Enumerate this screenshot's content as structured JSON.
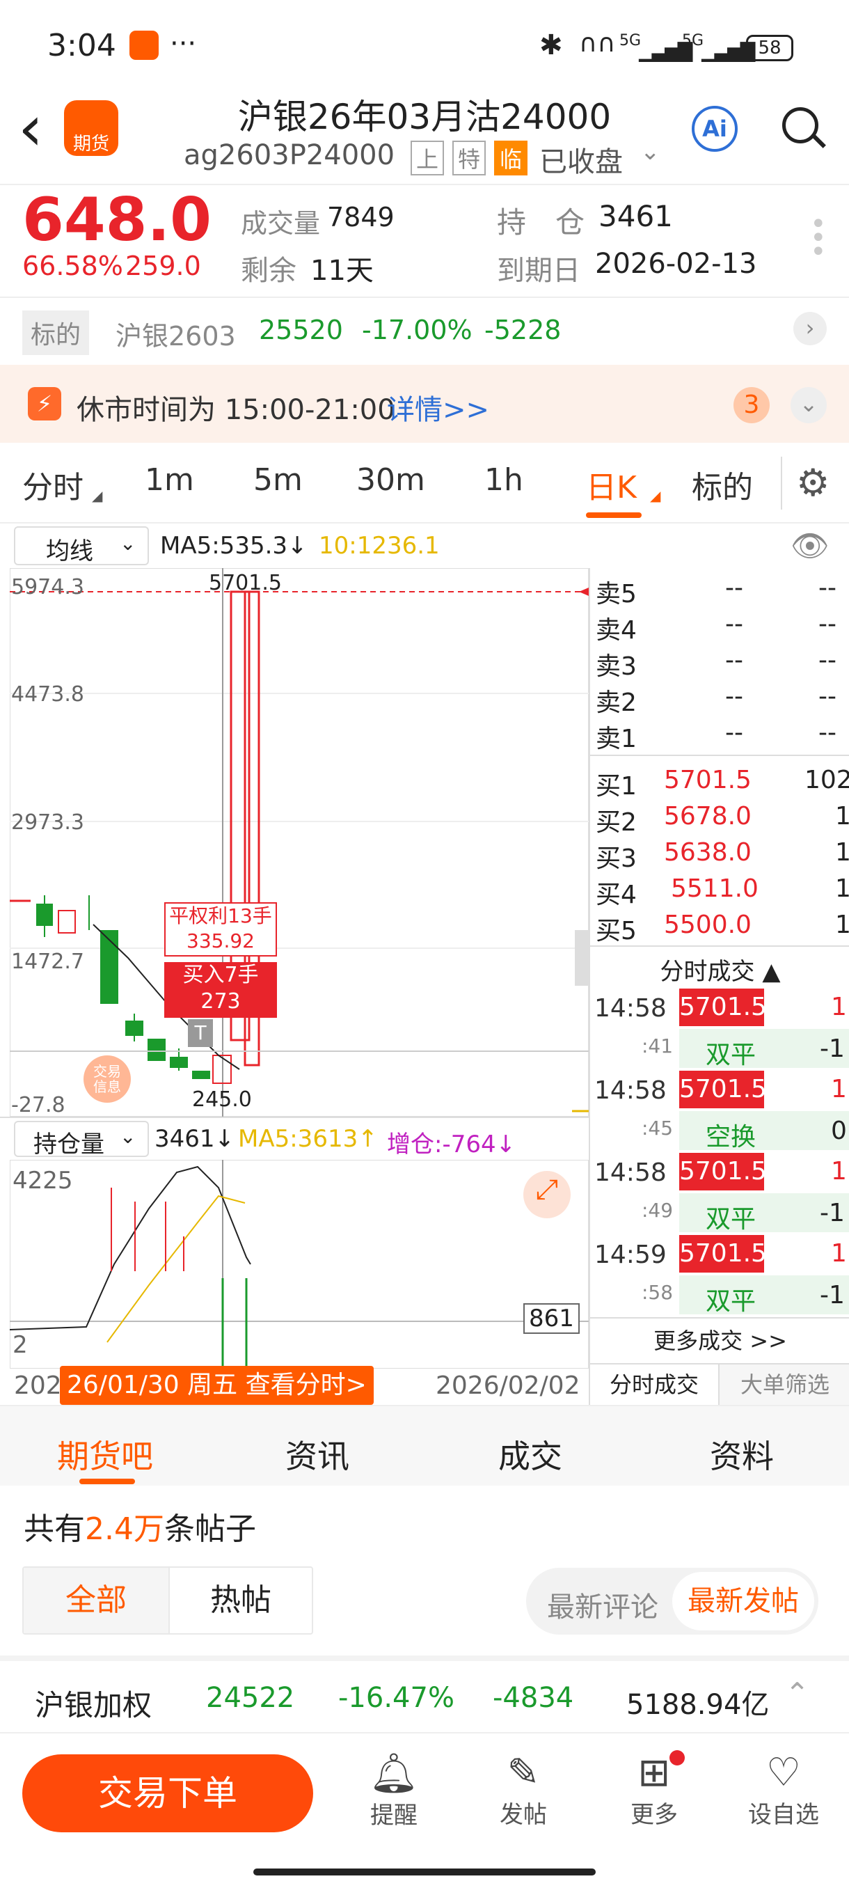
{
  "status": {
    "time": "3:04",
    "dots": "···",
    "battery": "58",
    "sig1": "5G",
    "sig2": "5G"
  },
  "header": {
    "back": "‹",
    "logo_text": "期货",
    "title": "沪银26年03月沽24000",
    "code": "ag2603P24000",
    "tags": [
      "上",
      "特",
      "临"
    ],
    "closed": "已收盘",
    "ai": "Ai"
  },
  "quote": {
    "price": "648.0",
    "change_pct": "66.58%",
    "change": "259.0",
    "volume_label": "成交量",
    "volume": "7849",
    "oi_label": "持　仓",
    "oi": "3461",
    "remain_label": "剩余",
    "remain": "11天",
    "expiry_label": "到期日",
    "expiry": "2026-02-13"
  },
  "underlying": {
    "tag": "标的",
    "name": "沪银2603",
    "price": "25520",
    "pct": "-17.00%",
    "chg": "-5228"
  },
  "notice": {
    "text": "休市时间为 15:00-21:00",
    "link": "详情>>",
    "badge": "3"
  },
  "tabs": [
    "分时",
    "1m",
    "5m",
    "30m",
    "1h",
    "日K",
    "标的"
  ],
  "ma": {
    "select": "均线",
    "ma5": "MA5:535.3↓",
    "ma10": "10:1236.1"
  },
  "chart": {
    "y": [
      "5974.3",
      "4473.8",
      "2973.3",
      "1472.7",
      "-27.8"
    ],
    "high_label": "5701.5",
    "low_label": "245.0",
    "ann1_l1": "平权利13手",
    "ann1_l2": "335.92",
    "ann2_l1": "买入7手",
    "ann2_l2": "273",
    "trade_info": "交易信息",
    "t_mark": "T"
  },
  "oi_chart": {
    "select": "持仓量",
    "value": "3461↓",
    "ma5": "MA5:3613↑",
    "add": "增仓:-764↓",
    "y_top": "4225",
    "y_bot": "2",
    "marker": "861",
    "date_left": "202",
    "date_tag": "26/01/30 周五 查看分时>",
    "date_right": "2026/02/02"
  },
  "sell": [
    {
      "l": "卖5",
      "p": "--",
      "v": "--"
    },
    {
      "l": "卖4",
      "p": "--",
      "v": "--"
    },
    {
      "l": "卖3",
      "p": "--",
      "v": "--"
    },
    {
      "l": "卖2",
      "p": "--",
      "v": "--"
    },
    {
      "l": "卖1",
      "p": "--",
      "v": "--"
    }
  ],
  "buy": [
    {
      "l": "买1",
      "p": "5701.5",
      "v": "102"
    },
    {
      "l": "买2",
      "p": "5678.0",
      "v": "1"
    },
    {
      "l": "买3",
      "p": "5638.0",
      "v": "1"
    },
    {
      "l": "买4",
      "p": "5511.0",
      "v": "1"
    },
    {
      "l": "买5",
      "p": "5500.0",
      "v": "1"
    }
  ],
  "trades_title": "分时成交",
  "trades": [
    {
      "t": "14:58",
      "s": ":41",
      "p": "5701.5",
      "v": "1",
      "type": "双平",
      "d": "-1"
    },
    {
      "t": "14:58",
      "s": ":45",
      "p": "5701.5",
      "v": "1",
      "type": "空换",
      "d": "0"
    },
    {
      "t": "14:58",
      "s": ":49",
      "p": "5701.5",
      "v": "1",
      "type": "双平",
      "d": "-1"
    },
    {
      "t": "14:59",
      "s": ":58",
      "p": "5701.5",
      "v": "1",
      "type": "双平",
      "d": "-1"
    }
  ],
  "more_trades": "更多成交 >>",
  "tab_trades": "分时成交",
  "tab_big": "大单筛选",
  "section_tabs": [
    "期货吧",
    "资讯",
    "成交",
    "资料"
  ],
  "posts": {
    "pre": "共有",
    "count": "2.4万",
    "post": "条帖子",
    "all": "全部",
    "hot": "热帖",
    "latest_comment": "最新评论",
    "latest_post": "最新发帖"
  },
  "ticker": {
    "name": "沪银加权",
    "price": "24522",
    "pct": "-16.47%",
    "chg": "-4834",
    "amount": "5188.94亿"
  },
  "bottom": {
    "order": "交易下单",
    "remind": "提醒",
    "post": "发帖",
    "more": "更多",
    "watch": "设自选"
  },
  "colors": {
    "accent": "#ff5a00",
    "red": "#e8242b",
    "green": "#1a9a2c"
  }
}
